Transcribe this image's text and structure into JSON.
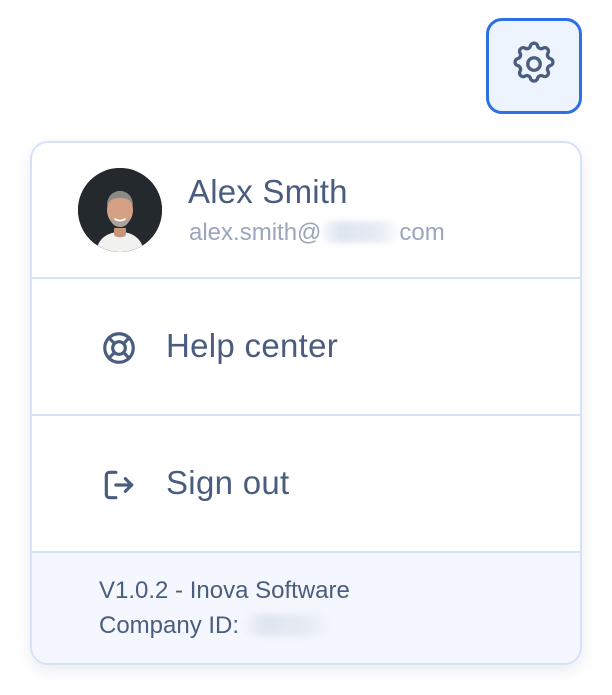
{
  "settings": {
    "icon": "gear-icon"
  },
  "profile": {
    "name": "Alex Smith",
    "email_prefix": "alex.smith@",
    "email_suffix": "com"
  },
  "menu": {
    "help_label": "Help center",
    "help_icon": "lifebuoy-icon",
    "signout_label": "Sign out",
    "signout_icon": "sign-out-icon"
  },
  "footer": {
    "version": "V1.0.2 - Inova Software",
    "company_label": "Company ID:"
  },
  "colors": {
    "accent": "#2f6fe4",
    "text": "#4a5d7e",
    "muted_text": "#9aa6bd",
    "border": "#d6e2f5",
    "footer_bg": "#f4f7fd"
  }
}
